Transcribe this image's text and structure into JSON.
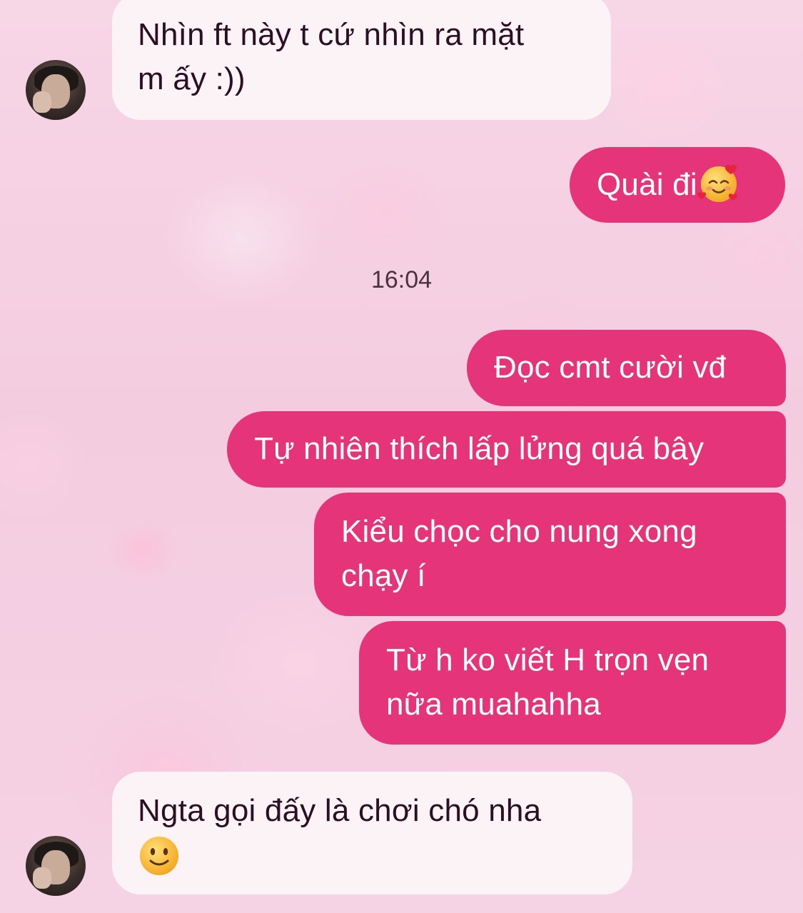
{
  "messages": [
    {
      "direction": "incoming",
      "lines": [
        "Nhìn ft này t cứ nhìn ra mặt",
        "m ấy :))"
      ]
    },
    {
      "direction": "outgoing",
      "text": "Quài đi",
      "emoji": "smiling-face-with-hearts-icon"
    },
    {
      "direction": "outgoing",
      "text": "Đọc cmt cười vđ"
    },
    {
      "direction": "outgoing",
      "text": "Tự nhiên thích lấp lửng quá bây"
    },
    {
      "direction": "outgoing",
      "lines": [
        "Kiểu chọc cho nung xong",
        "chạy í"
      ]
    },
    {
      "direction": "outgoing",
      "lines": [
        "Từ h ko viết H trọn vẹn",
        "nữa muahahha"
      ]
    },
    {
      "direction": "incoming",
      "lines": [
        "Ngta gọi đấy là chơi chó nha"
      ],
      "emoji": "slightly-smiling-face-icon"
    }
  ],
  "timestamp": "16:04",
  "colors": {
    "outgoing_bubble": "#e6347b",
    "incoming_bubble": "#fcf3f6",
    "background": "#f6d3e4"
  }
}
